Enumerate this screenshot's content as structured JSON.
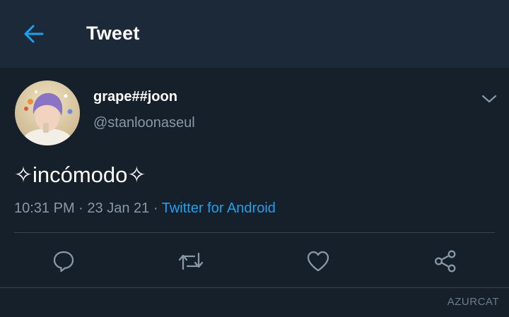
{
  "header": {
    "title": "Tweet",
    "back_icon": "back-arrow-icon",
    "accent": "#1da1f2",
    "background": "#1c2938"
  },
  "tweet": {
    "author_name": "grape##joon",
    "author_handle": "@stanloonaseul",
    "text": "✧incómodo✧",
    "time": "10:31 PM",
    "date": "23 Jan 21",
    "separator": "·",
    "source": "Twitter for Android",
    "more_icon": "chevron-down-icon"
  },
  "actions": [
    {
      "icon": "reply-icon"
    },
    {
      "icon": "retweet-icon"
    },
    {
      "icon": "like-icon"
    },
    {
      "icon": "share-icon"
    }
  ],
  "watermark": "AZURCAT",
  "colors": {
    "background": "#15202b",
    "secondary_text": "#8899a6",
    "divider": "#38444d"
  }
}
